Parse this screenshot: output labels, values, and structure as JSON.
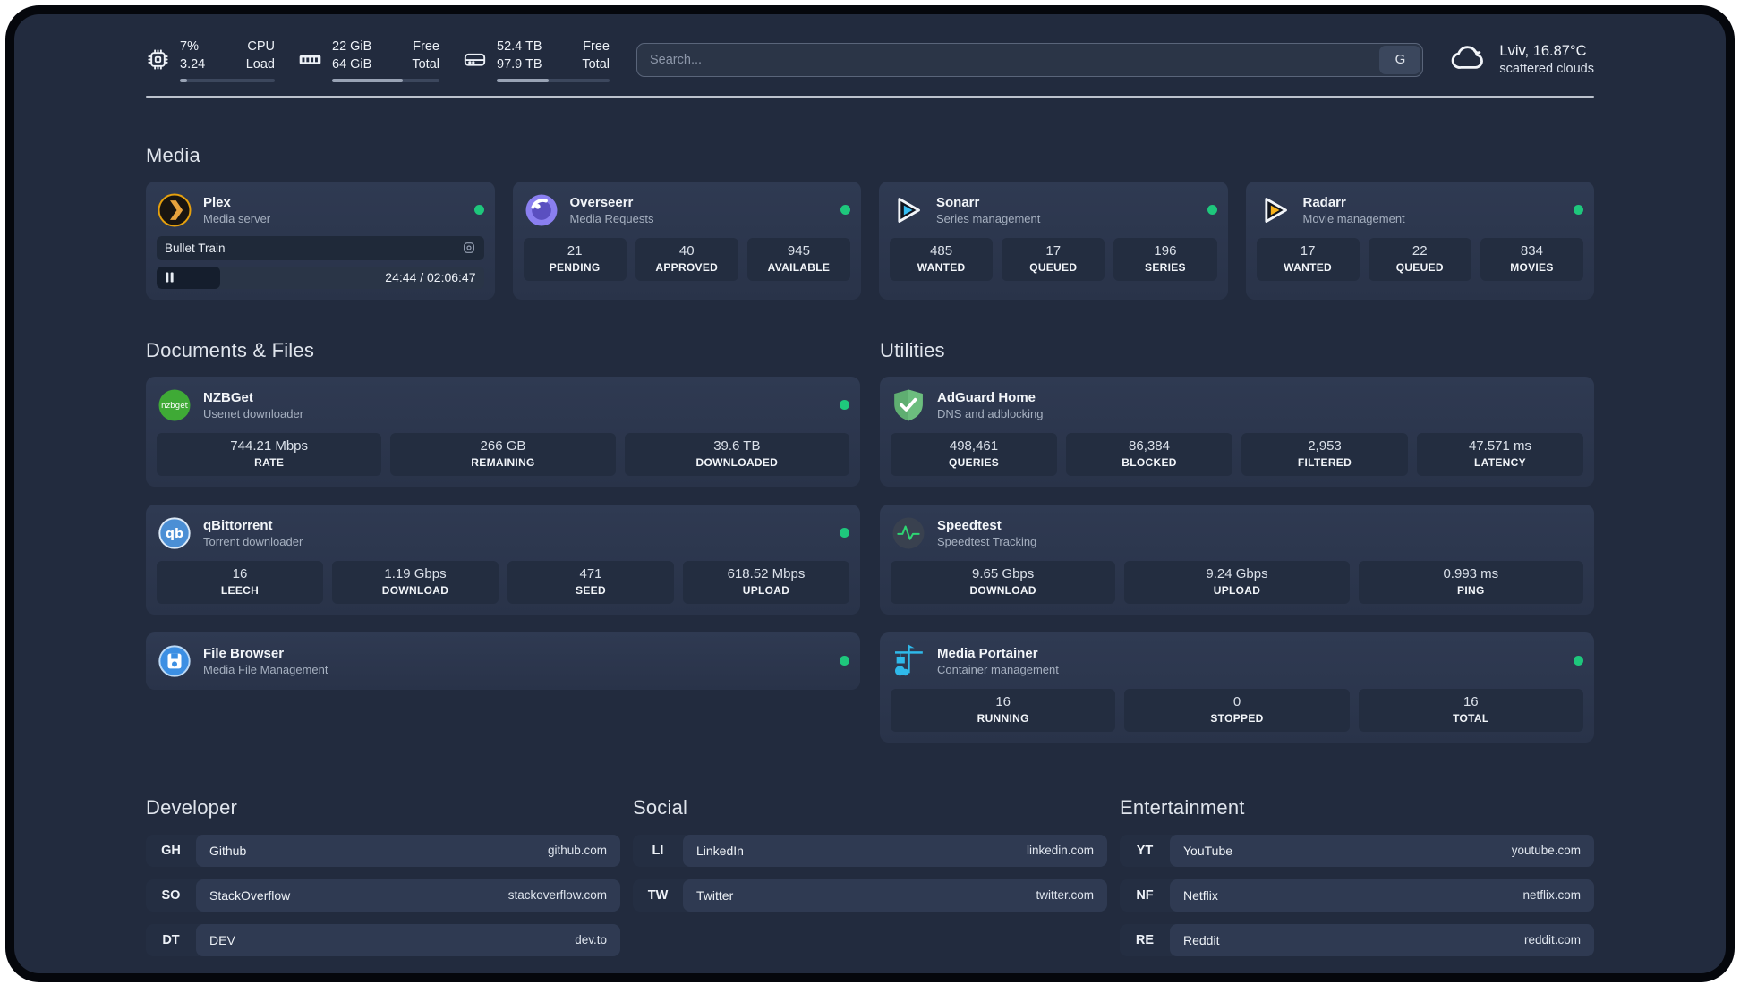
{
  "topbar": {
    "stats": [
      {
        "icon": "cpu-icon",
        "left_top": "7%",
        "left_bottom": "3.24",
        "right_top": "CPU",
        "right_bottom": "Load",
        "progress": 8
      },
      {
        "icon": "ram-icon",
        "left_top": "22 GiB",
        "left_bottom": "64 GiB",
        "right_top": "Free",
        "right_bottom": "Total",
        "progress": 66
      },
      {
        "icon": "disk-icon",
        "left_top": "52.4 TB",
        "left_bottom": "97.9 TB",
        "right_top": "Free",
        "right_bottom": "Total",
        "progress": 46
      }
    ],
    "search": {
      "placeholder": "Search...",
      "button_label": "G"
    },
    "weather": {
      "location": "Lviv, 16.87°C",
      "condition": "scattered clouds"
    }
  },
  "media": {
    "title": "Media",
    "plex": {
      "name": "Plex",
      "subtitle": "Media server",
      "online": true,
      "now_playing": {
        "title": "Bullet Train",
        "time": "24:44 / 02:06:47",
        "progress_pct": 19.5
      }
    },
    "apps": [
      {
        "name": "Overseerr",
        "subtitle": "Media Requests",
        "online": true,
        "stats": [
          {
            "value": "21",
            "label": "PENDING"
          },
          {
            "value": "40",
            "label": "APPROVED"
          },
          {
            "value": "945",
            "label": "AVAILABLE"
          }
        ]
      },
      {
        "name": "Sonarr",
        "subtitle": "Series management",
        "online": true,
        "stats": [
          {
            "value": "485",
            "label": "WANTED"
          },
          {
            "value": "17",
            "label": "QUEUED"
          },
          {
            "value": "196",
            "label": "SERIES"
          }
        ]
      },
      {
        "name": "Radarr",
        "subtitle": "Movie management",
        "online": true,
        "stats": [
          {
            "value": "17",
            "label": "WANTED"
          },
          {
            "value": "22",
            "label": "QUEUED"
          },
          {
            "value": "834",
            "label": "MOVIES"
          }
        ]
      }
    ]
  },
  "documents": {
    "title": "Documents & Files",
    "apps": [
      {
        "name": "NZBGet",
        "subtitle": "Usenet downloader",
        "online": true,
        "stats": [
          {
            "value": "744.21 Mbps",
            "label": "RATE"
          },
          {
            "value": "266 GB",
            "label": "REMAINING"
          },
          {
            "value": "39.6 TB",
            "label": "DOWNLOADED"
          }
        ]
      },
      {
        "name": "qBittorrent",
        "subtitle": "Torrent downloader",
        "online": true,
        "stats": [
          {
            "value": "16",
            "label": "LEECH"
          },
          {
            "value": "1.19 Gbps",
            "label": "DOWNLOAD"
          },
          {
            "value": "471",
            "label": "SEED"
          },
          {
            "value": "618.52 Mbps",
            "label": "UPLOAD"
          }
        ]
      },
      {
        "name": "File Browser",
        "subtitle": "Media File Management",
        "online": true,
        "stats": []
      }
    ]
  },
  "utilities": {
    "title": "Utilities",
    "apps": [
      {
        "name": "AdGuard Home",
        "subtitle": "DNS and adblocking",
        "online": false,
        "stats": [
          {
            "value": "498,461",
            "label": "QUERIES"
          },
          {
            "value": "86,384",
            "label": "BLOCKED"
          },
          {
            "value": "2,953",
            "label": "FILTERED"
          },
          {
            "value": "47.571 ms",
            "label": "LATENCY"
          }
        ]
      },
      {
        "name": "Speedtest",
        "subtitle": "Speedtest Tracking",
        "online": false,
        "stats": [
          {
            "value": "9.65 Gbps",
            "label": "DOWNLOAD"
          },
          {
            "value": "9.24 Gbps",
            "label": "UPLOAD"
          },
          {
            "value": "0.993 ms",
            "label": "PING"
          }
        ]
      },
      {
        "name": "Media Portainer",
        "subtitle": "Container management",
        "online": true,
        "stats": [
          {
            "value": "16",
            "label": "RUNNING"
          },
          {
            "value": "0",
            "label": "STOPPED"
          },
          {
            "value": "16",
            "label": "TOTAL"
          }
        ]
      }
    ]
  },
  "link_sections": [
    {
      "title": "Developer",
      "links": [
        {
          "tag": "GH",
          "name": "Github",
          "domain": "github.com"
        },
        {
          "tag": "SO",
          "name": "StackOverflow",
          "domain": "stackoverflow.com"
        },
        {
          "tag": "DT",
          "name": "DEV",
          "domain": "dev.to"
        }
      ]
    },
    {
      "title": "Social",
      "links": [
        {
          "tag": "LI",
          "name": "LinkedIn",
          "domain": "linkedin.com"
        },
        {
          "tag": "TW",
          "name": "Twitter",
          "domain": "twitter.com"
        }
      ]
    },
    {
      "title": "Entertainment",
      "links": [
        {
          "tag": "YT",
          "name": "YouTube",
          "domain": "youtube.com"
        },
        {
          "tag": "NF",
          "name": "Netflix",
          "domain": "netflix.com"
        },
        {
          "tag": "RE",
          "name": "Reddit",
          "domain": "reddit.com"
        }
      ]
    }
  ],
  "colors": {
    "background": "#222b3e",
    "card": "#2d3850",
    "accent_green": "#1ec77c",
    "plex_amber": "#e5a00d"
  }
}
